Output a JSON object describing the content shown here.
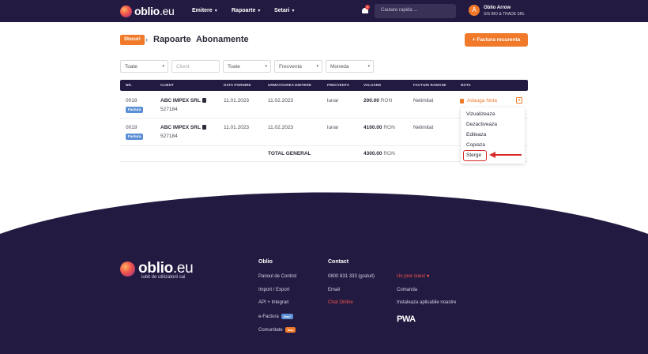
{
  "brand": {
    "name": "oblio",
    "tld": ".eu"
  },
  "nav": {
    "items": [
      {
        "label": "Emitere"
      },
      {
        "label": "Rapoarte"
      },
      {
        "label": "Setari"
      }
    ],
    "notification_count": "1",
    "search_placeholder": "Cautare rapida ...",
    "user": {
      "initial": "A",
      "name": "Oblio Arrow",
      "company": "SIS BIO & TRADE SRL"
    }
  },
  "breadcrumb": {
    "badge": "Stocuri",
    "items": [
      "Rapoarte",
      "Abonamente"
    ]
  },
  "primary_action": "Factura recurenta",
  "filters": [
    {
      "value": "Toate",
      "placeholder": false
    },
    {
      "value": "Client",
      "placeholder": true
    },
    {
      "value": "Toate",
      "placeholder": false
    },
    {
      "value": "Frecventa",
      "placeholder": false
    },
    {
      "value": "Moneda",
      "placeholder": false
    }
  ],
  "table": {
    "headers": [
      "NR.",
      "CLIENT",
      "DATA PORNIRE",
      "URMATOAREA EMITERE",
      "FRECVENTA",
      "VALOARE",
      "FACTURI RAMASE",
      "NOTA"
    ],
    "rows": [
      {
        "nr": "0018",
        "tag": "Factura",
        "client": "ABC IMPEX SRL",
        "client_code": "527184",
        "start": "11.01.2023",
        "next": "11.02.2023",
        "frequency": "lunar",
        "value": "200.00",
        "currency": "RON",
        "remaining": "Nelimitat"
      },
      {
        "nr": "0019",
        "tag": "Factura",
        "client": "ABC IMPEX SRL",
        "client_code": "527184",
        "start": "11.01.2023",
        "next": "11.02.2023",
        "frequency": "lunar",
        "value": "4100.00",
        "currency": "RON",
        "remaining": "Nelimitat"
      }
    ],
    "total_label": "TOTAL GENERAL",
    "total_value": "4300.00",
    "total_currency": "RON",
    "note_link": "Adauga Nota"
  },
  "dropdown": {
    "items": [
      "Vizualizeaza",
      "Dezactiveaza",
      "Editeaza",
      "Copiaza",
      "Sterge"
    ]
  },
  "footer": {
    "tagline": "iubit de utilizatorii sai",
    "col1": {
      "title": "Oblio",
      "links": [
        "Panoul de Control",
        "Import / Export",
        "API + Integrari",
        "e-Factura",
        "Comunitate"
      ],
      "badges": {
        "e-Factura": "Nou!",
        "Comunitate": "Nou"
      }
    },
    "col2": {
      "title": "Contact",
      "links": [
        "0800 831 333 (gratuit)",
        "Email",
        "Chat Online"
      ]
    },
    "col3": {
      "links": [
        "Un pret onest",
        "Comanda",
        "Instaleaza aplicatiile noastre"
      ]
    },
    "pwa_label": "PWA"
  },
  "colors": {
    "nav_bg": "#231a41",
    "accent": "#f07a2a",
    "danger": "#d92a2a",
    "tag_blue": "#5b8fd6"
  }
}
